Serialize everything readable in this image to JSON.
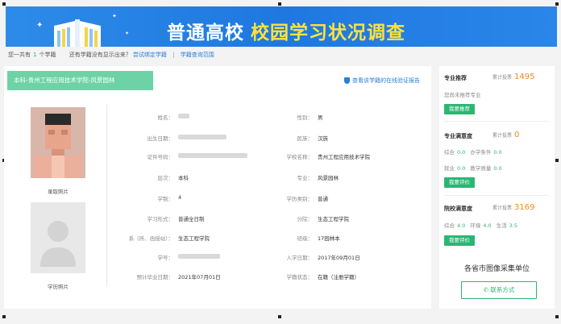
{
  "banner": {
    "title_white": "普通高校",
    "title_yellow": "校园学习状况调查"
  },
  "info_bar": {
    "prefix": "您一共有",
    "count": "1",
    "suffix": "个学籍",
    "question": "还有学籍没有显示出来？",
    "bind_link": "尝试绑定学籍",
    "scope_link": "学籍查询范围"
  },
  "record": {
    "tag": "本科-贵州工程应用技术学院-风景园林",
    "verify_link": "查看该学籍的在线验证报告",
    "photo_admission_label": "录取照片",
    "photo_degree_label": "学历照片"
  },
  "fields_left": [
    {
      "label": "姓名：",
      "value": ""
    },
    {
      "label": "出生日期：",
      "value": ""
    },
    {
      "label": "证件号码：",
      "value": ""
    },
    {
      "label": "层次：",
      "value": "本科"
    },
    {
      "label": "学制：",
      "value": "4"
    },
    {
      "label": "学习形式：",
      "value": "普通全日制"
    },
    {
      "label": "系（所、函授站）：",
      "value": "生态工程学院"
    },
    {
      "label": "学号：",
      "value": ""
    },
    {
      "label": "预计毕业日期：",
      "value": "2021年07月01日"
    }
  ],
  "fields_right": [
    {
      "label": "性别：",
      "value": "男"
    },
    {
      "label": "民族：",
      "value": "汉族"
    },
    {
      "label": "学校名称：",
      "value": "贵州工程应用技术学院"
    },
    {
      "label": "专业：",
      "value": "风景园林"
    },
    {
      "label": "学历类别：",
      "value": "普通"
    },
    {
      "label": "分院：",
      "value": "生态工程学院"
    },
    {
      "label": "班级：",
      "value": "17园林本"
    },
    {
      "label": "入学日期：",
      "value": "2017年09月01日"
    },
    {
      "label": "学籍状态：",
      "value": "在籍（注册学籍）"
    }
  ],
  "sidebar": {
    "recommend": {
      "title": "专业推荐",
      "vote_label": "累计投票",
      "votes": "1495",
      "note": "您尚未推荐专业",
      "button": "我要推荐"
    },
    "major_satisfaction": {
      "title": "专业满意度",
      "vote_label": "累计投票",
      "votes": "0",
      "r1_l1": "综合",
      "r1_v1": "0.0",
      "r1_l2": "办学条件",
      "r1_v2": "0.0",
      "r2_l1": "就业",
      "r2_v1": "0.0",
      "r2_l2": "教学质量",
      "r2_v2": "0.0",
      "button": "我要评价"
    },
    "school_satisfaction": {
      "title": "院校满意度",
      "vote_label": "累计投票",
      "votes": "3169",
      "l1": "综合",
      "v1": "4.0",
      "l2": "环境",
      "v2": "4.0",
      "l3": "生活",
      "v3": "3.5",
      "button": "我要评价"
    },
    "region_title": "各省市图像采集单位",
    "contact_button": "联系方式",
    "phone_icon": "phone-icon"
  },
  "colors": {
    "banner_blue": "#1f78e0",
    "accent_green": "#2bb673",
    "tag_green": "#6dd3a6",
    "vote_orange": "#f08a1c",
    "link_blue": "#2a7fd8",
    "title_yellow": "#ffe23a"
  }
}
